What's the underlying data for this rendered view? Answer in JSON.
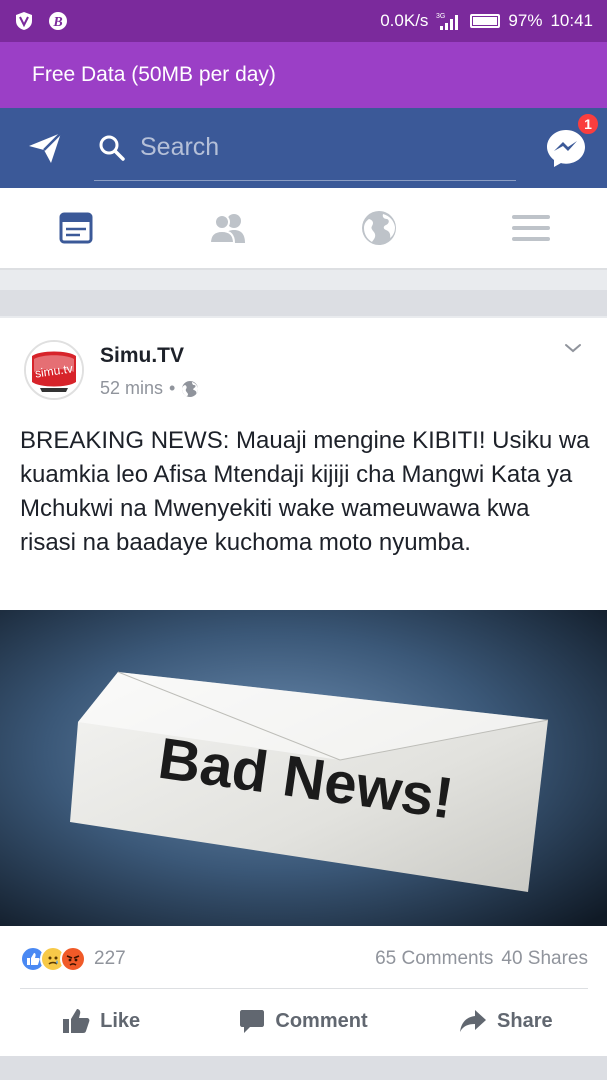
{
  "status_bar": {
    "left_icons": [
      "shield-v-icon",
      "b-circle-icon"
    ],
    "speed": "0.0K/s",
    "network": "3G",
    "battery": "97%",
    "time": "10:41"
  },
  "banner": {
    "text": "Free Data (50MB per day)"
  },
  "header": {
    "search_placeholder": "Search",
    "messenger_badge": "1"
  },
  "tabs": [
    {
      "name": "news-feed",
      "active": true
    },
    {
      "name": "friends",
      "active": false
    },
    {
      "name": "notifications",
      "active": false
    },
    {
      "name": "menu",
      "active": false
    }
  ],
  "post": {
    "page_name": "Simu.TV",
    "avatar_text": "simu.tv",
    "time": "52 mins",
    "separator": "•",
    "text": "BREAKING NEWS: Mauaji mengine KIBITI! Usiku wa kuamkia leo Afisa Mtendaji kijiji cha Mangwi Kata ya Mchukwi na Mwenyekiti wake wameuwawa kwa risasi na baadaye kuchoma moto nyumba.",
    "image_text": "Bad News!",
    "reactions_count": "227",
    "comments": "65 Comments",
    "shares": "40 Shares",
    "actions": {
      "like": "Like",
      "comment": "Comment",
      "share": "Share"
    }
  },
  "colors": {
    "status_bar": "#7b2a9c",
    "banner": "#9b3fc6",
    "facebook_blue": "#3b5998",
    "active_tab": "#3b5998",
    "inactive_tab": "#bec3c9"
  }
}
